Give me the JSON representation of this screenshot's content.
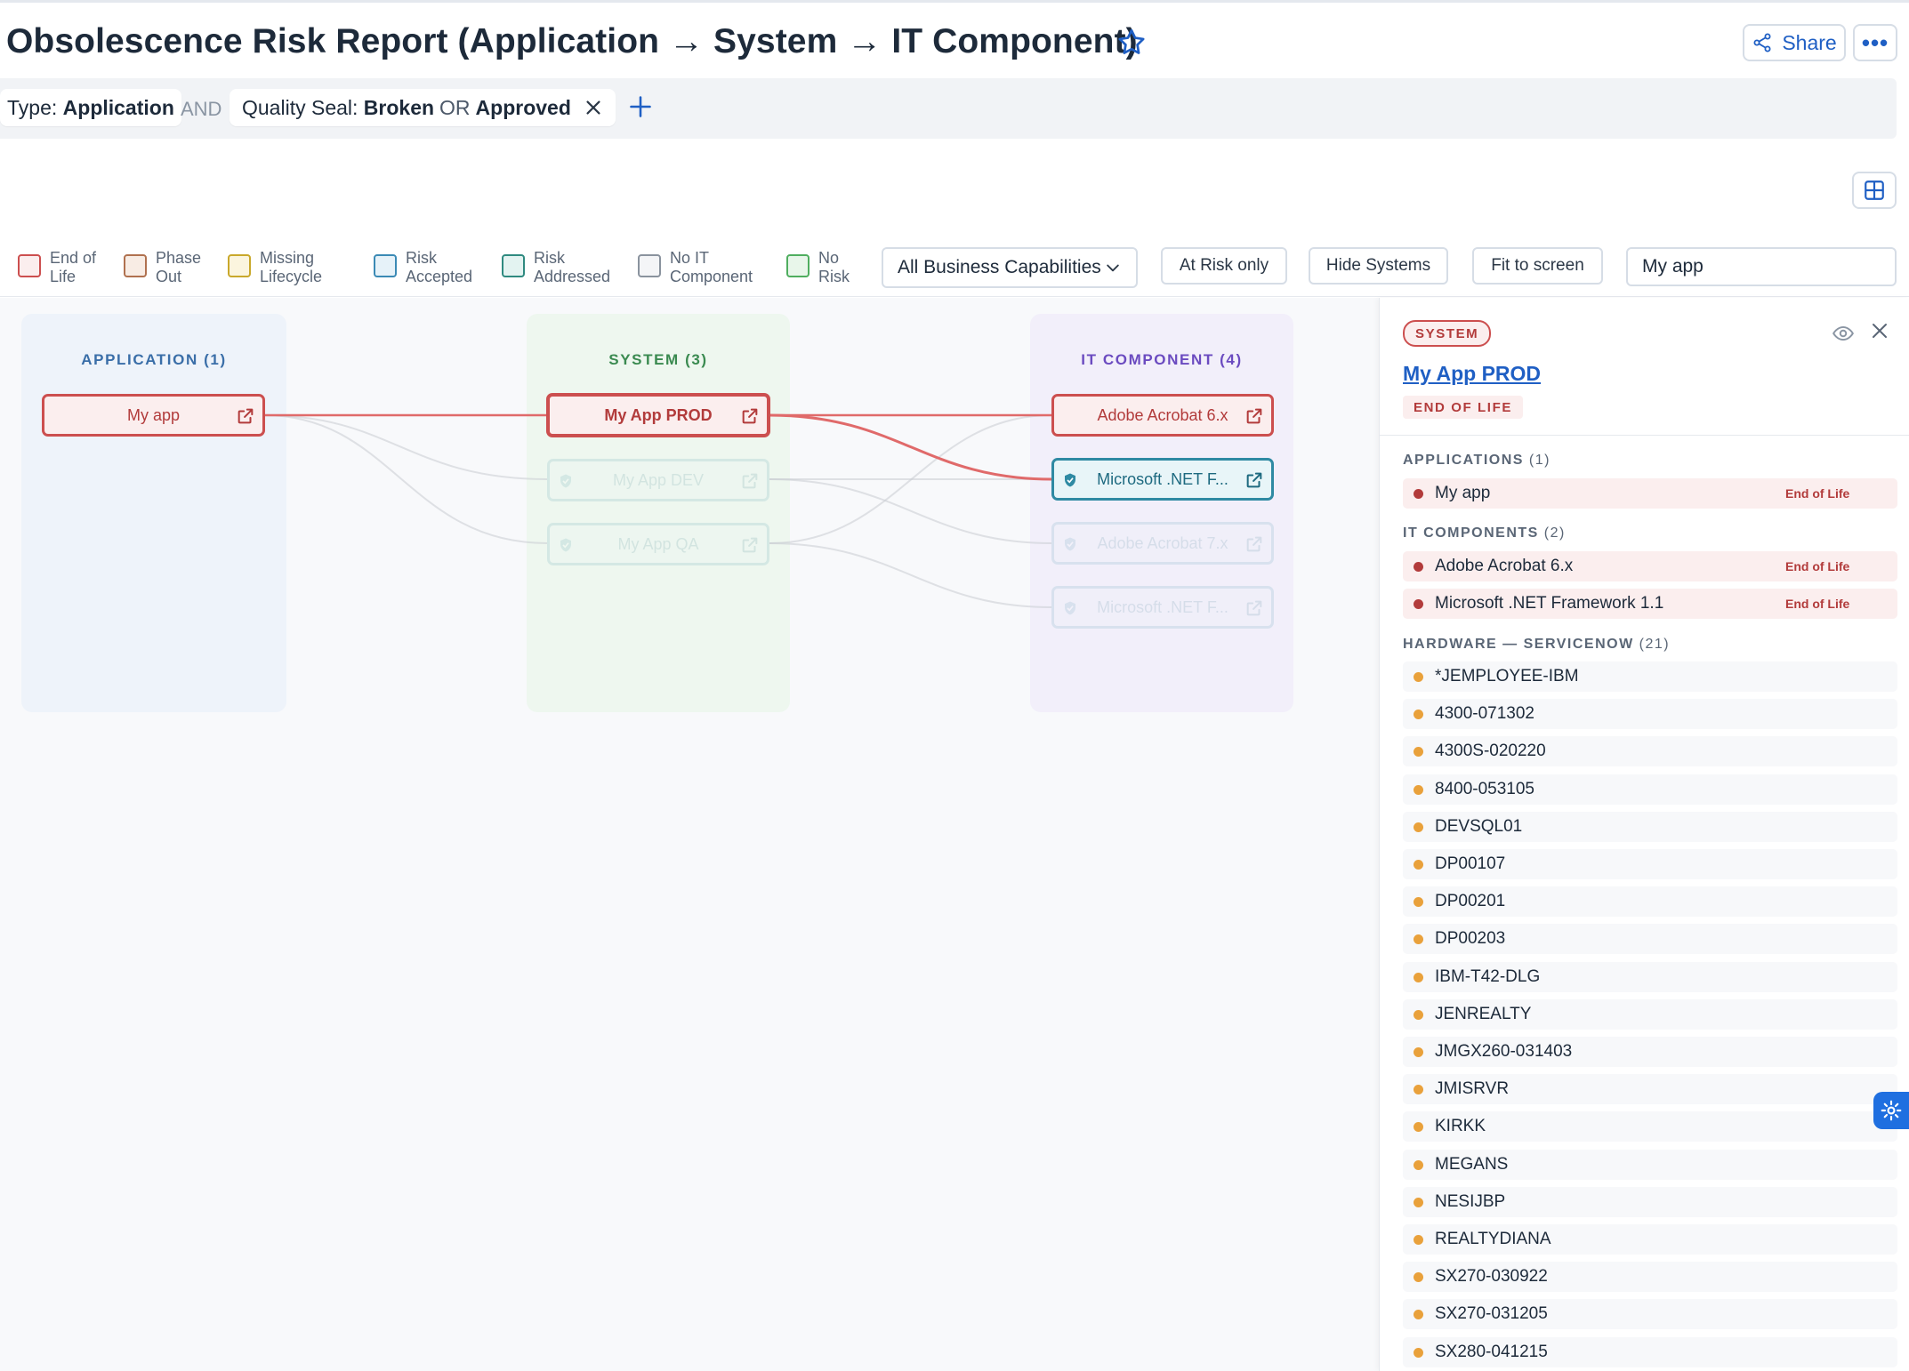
{
  "header": {
    "title": "Obsolescence Risk Report (Application → System → IT Component)",
    "share_label": "Share",
    "more_label": "•••"
  },
  "filters": {
    "type_key": "Type:",
    "type_value": "Application",
    "and_label": "AND",
    "seal_key": "Quality Seal:",
    "seal_value_1": "Broken",
    "seal_or": "OR",
    "seal_value_2": "Approved"
  },
  "legend": [
    {
      "line1": "End of",
      "line2": "Life",
      "color": "#cc4f4f",
      "fill": "#fbeeee"
    },
    {
      "line1": "Phase",
      "line2": "Out",
      "color": "#b0714f",
      "fill": "#f8ece4"
    },
    {
      "line1": "Missing",
      "line2": "Lifecycle",
      "color": "#c9a82b",
      "fill": "#fbf5de"
    },
    {
      "line1": "Risk",
      "line2": "Accepted",
      "color": "#3b8ab5",
      "fill": "#e6f2f9"
    },
    {
      "line1": "Risk",
      "line2": "Addressed",
      "color": "#2f8a80",
      "fill": "#e3f3f1"
    },
    {
      "line1": "No IT",
      "line2": "Component",
      "color": "#8a939e",
      "fill": "#f4f5f7"
    },
    {
      "line1": "No",
      "line2": "Risk",
      "color": "#4fae5f",
      "fill": "#e8f6ea"
    }
  ],
  "toolbar": {
    "capability_select": "All Business Capabilities",
    "at_risk_label": "At Risk only",
    "hide_systems_label": "Hide Systems",
    "fit_label": "Fit to screen",
    "search_value": "My app"
  },
  "lanes": {
    "application": "APPLICATION (1)",
    "system": "SYSTEM (3)",
    "it_component": "IT COMPONENT (4)"
  },
  "nodes": {
    "app_my_app": "My app",
    "sys_prod": "My App PROD",
    "sys_dev": "My App DEV",
    "sys_qa": "My App QA",
    "itc_acrobat6": "Adobe Acrobat 6.x",
    "itc_net11": "Microsoft .NET F...",
    "itc_acrobat7": "Adobe Acrobat 7.x",
    "itc_net_other": "Microsoft .NET F..."
  },
  "panel": {
    "type_badge": "SYSTEM",
    "title": "My App PROD",
    "status": "END OF LIFE",
    "applications_head": "APPLICATIONS",
    "applications_count": "(1)",
    "applications": [
      {
        "name": "My app",
        "tag": "End of Life"
      }
    ],
    "itc_head": "IT COMPONENTS",
    "itc_count": "(2)",
    "it_components": [
      {
        "name": "Adobe Acrobat 6.x",
        "tag": "End of Life"
      },
      {
        "name": "Microsoft .NET Framework 1.1",
        "tag": "End of Life"
      }
    ],
    "hw_head": "HARDWARE — SERVICENOW",
    "hw_count": "(21)",
    "hardware": [
      "*JEMPLOYEE-IBM",
      "4300-071302",
      "4300S-020220",
      "8400-053105",
      "DEVSQL01",
      "DP00107",
      "DP00201",
      "DP00203",
      "IBM-T42-DLG",
      "JENREALTY",
      "JMGX260-031403",
      "JMISRVR",
      "KIRKK",
      "MEGANS",
      "NESIJBP",
      "REALTYDIANA",
      "SX270-030922",
      "SX270-031205",
      "SX280-041215"
    ]
  }
}
